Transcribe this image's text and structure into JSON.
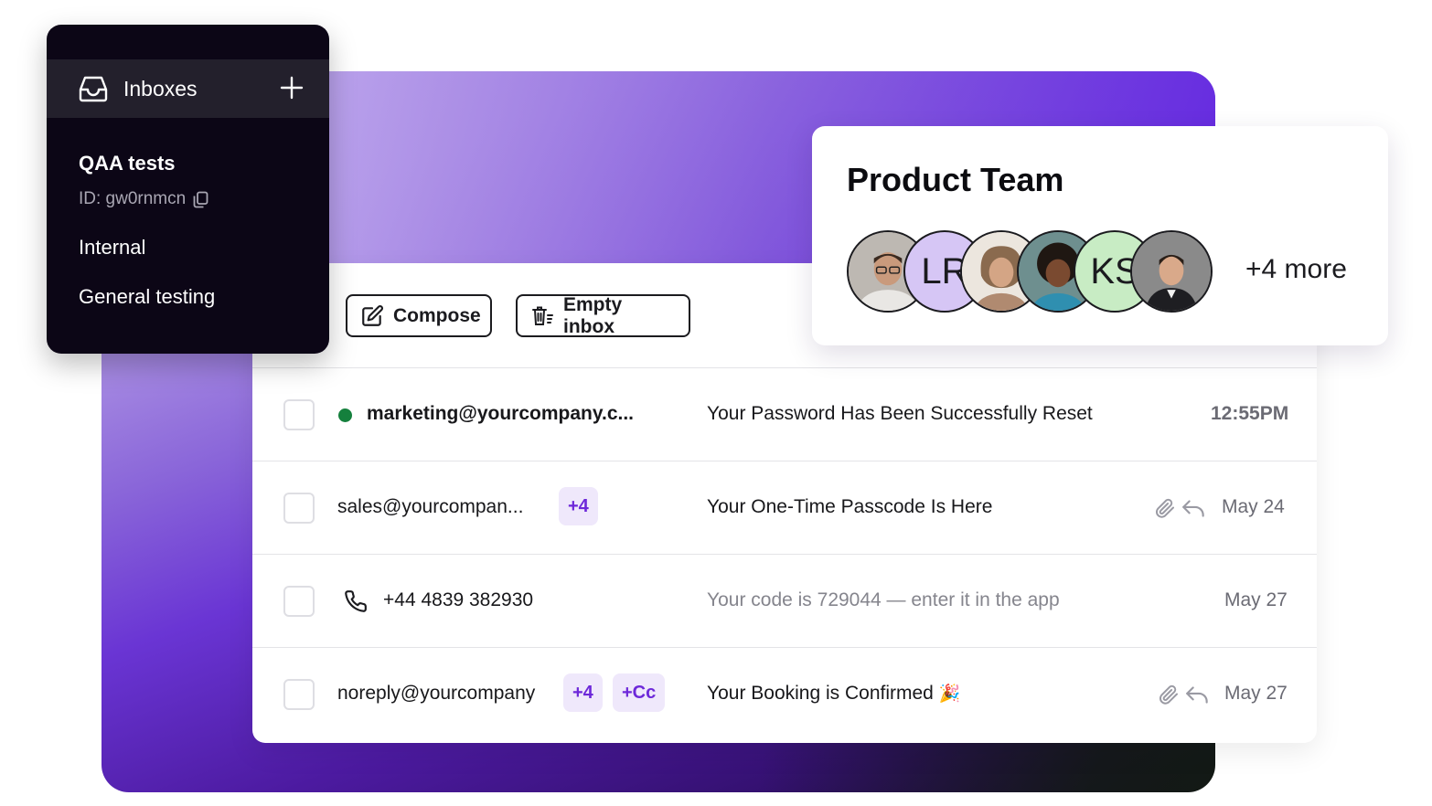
{
  "sidebar": {
    "header_label": "Inboxes",
    "title": "QAA tests",
    "id_text": "ID: gw0rnmcn",
    "items": [
      {
        "label": "Internal"
      },
      {
        "label": "General testing"
      }
    ]
  },
  "toolbar": {
    "compose_label": "Compose",
    "empty_label": "Empty inbox"
  },
  "emails": [
    {
      "sender": "marketing@yourcompany.c...",
      "unread": true,
      "subject": "Your Password Has Been Successfully Reset",
      "date": "12:55PM"
    },
    {
      "sender": "sales@yourcompan...",
      "badges": [
        "+4"
      ],
      "subject": "Your One-Time Passcode Is Here",
      "date": "May 24",
      "icons": [
        "paperclip-icon",
        "reply-icon"
      ]
    },
    {
      "sender": "+44 4839 382930",
      "type": "sms",
      "subject": "Your code is 729044 — enter it in the app",
      "date": "May 27"
    },
    {
      "sender": "noreply@yourcompany",
      "badges": [
        "+4",
        "+Cc"
      ],
      "subject": "Your Booking is Confirmed",
      "emoji": "🎉",
      "date": "May 27",
      "icons": [
        "paperclip-icon",
        "reply-icon"
      ]
    }
  ],
  "team": {
    "title": "Product Team",
    "avatars": [
      {
        "type": "photo"
      },
      {
        "type": "initials",
        "initials": "LR",
        "color": "#d6c6f5"
      },
      {
        "type": "photo"
      },
      {
        "type": "photo"
      },
      {
        "type": "initials",
        "initials": "KS",
        "color": "#c8ecc4"
      },
      {
        "type": "photo"
      }
    ],
    "more": "+4 more"
  },
  "colors": {
    "accent": "#6d28d9",
    "unread_dot": "#15803d",
    "panel_bg": "#0c0616"
  }
}
